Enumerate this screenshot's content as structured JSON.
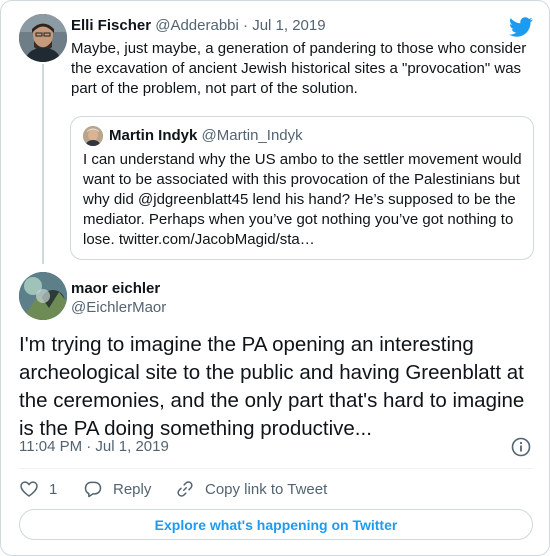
{
  "parent_tweet": {
    "author_name": "Elli Fischer",
    "author_handle": "@Adderabbi",
    "separator": "·",
    "date": "Jul 1, 2019",
    "text": "Maybe, just maybe, a generation of pandering to those who consider the excavation of ancient Jewish historical sites a \"provocation\" was part of the problem, not part of the solution."
  },
  "quoted_tweet": {
    "author_name": "Martin Indyk",
    "author_handle": "@Martin_Indyk",
    "text": "I can understand why the US ambo to the settler movement would want to be associated with this provocation of the Palestinians but why did @jdgreenblatt45 lend his hand? He’s supposed to be the mediator. Perhaps when you’ve got nothing you’ve got nothing to lose. twitter.com/JacobMagid/sta…"
  },
  "main_tweet": {
    "author_name": "maor eichler",
    "author_handle": "@EichlerMaor",
    "text": "I'm trying to imagine the PA opening an interesting archeological site to the public and having Greenblatt at the ceremonies, and the only part that's hard to imagine is the PA doing something productive...",
    "timestamp": "11:04 PM · Jul 1, 2019"
  },
  "actions": {
    "like_count": "1",
    "reply_label": "Reply",
    "copy_link_label": "Copy link to Tweet"
  },
  "explore_label": "Explore what's happening on Twitter",
  "icons": {
    "brand": "twitter-bird-icon",
    "info": "info-icon",
    "like": "heart-icon",
    "reply": "reply-icon",
    "copy": "link-icon"
  },
  "colors": {
    "brand_blue": "#1d9bf0",
    "text": "#0f1419",
    "muted": "#536471",
    "border": "#cfd9de"
  }
}
